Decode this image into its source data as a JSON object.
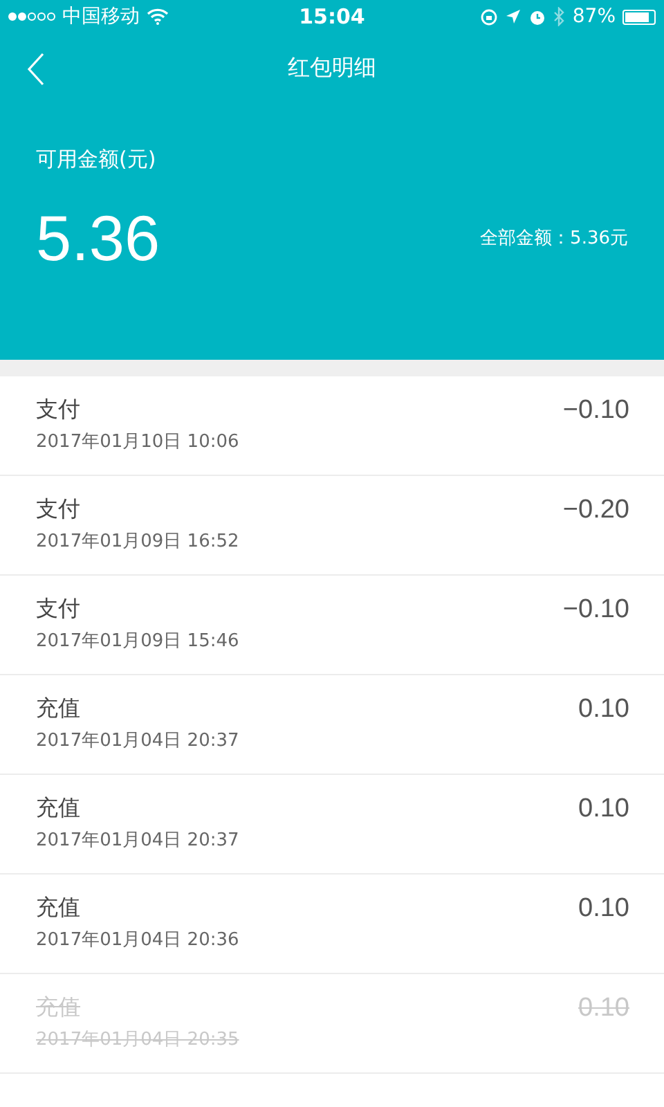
{
  "status_bar": {
    "carrier": "中国移动",
    "time": "15:04",
    "battery": "87%"
  },
  "nav": {
    "title": "红包明细"
  },
  "balance": {
    "label": "可用金额(元)",
    "amount": "5.36",
    "total": "全部金额：5.36元"
  },
  "records": [
    {
      "type": "支付",
      "time": "2017年01月10日 10:06",
      "amount": "−0.10",
      "cancelled": false
    },
    {
      "type": "支付",
      "time": "2017年01月09日 16:52",
      "amount": "−0.20",
      "cancelled": false
    },
    {
      "type": "支付",
      "time": "2017年01月09日 15:46",
      "amount": "−0.10",
      "cancelled": false
    },
    {
      "type": "充值",
      "time": "2017年01月04日 20:37",
      "amount": "0.10",
      "cancelled": false
    },
    {
      "type": "充值",
      "time": "2017年01月04日 20:37",
      "amount": "0.10",
      "cancelled": false
    },
    {
      "type": "充值",
      "time": "2017年01月04日 20:36",
      "amount": "0.10",
      "cancelled": false
    },
    {
      "type": "充值",
      "time": "2017年01月04日 20:35",
      "amount": "0.10",
      "cancelled": true
    }
  ]
}
